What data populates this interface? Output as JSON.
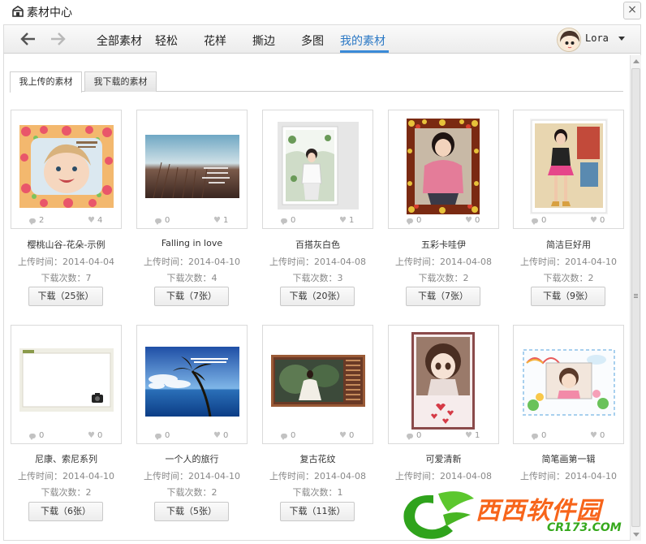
{
  "window": {
    "title": "素材中心",
    "close_glyph": "×"
  },
  "nav": {
    "tabs": [
      "全部素材",
      "轻松",
      "花样",
      "撕边",
      "多图",
      "我的素材"
    ],
    "active_tab_index": 5,
    "user_name": "Lora"
  },
  "sub_tabs": [
    "我上传的素材",
    "我下载的素材"
  ],
  "cards": [
    {
      "title": "樱桃山谷-花朵-示例",
      "date": "上传时间：2014-04-04",
      "downloads": "下载次数：7",
      "comments": "2",
      "likes": "4",
      "button": "下载（25张）"
    },
    {
      "title": "Falling in love",
      "date": "上传时间：2014-04-10",
      "downloads": "下载次数：4",
      "comments": "0",
      "likes": "1",
      "button": "下载（7张）"
    },
    {
      "title": "百搭灰白色",
      "date": "上传时间：2014-04-08",
      "downloads": "下载次数：3",
      "comments": "0",
      "likes": "1",
      "button": "下载（20张）"
    },
    {
      "title": "五彩卡哇伊",
      "date": "上传时间：2014-04-08",
      "downloads": "下载次数：2",
      "comments": "0",
      "likes": "0",
      "button": "下载（7张）"
    },
    {
      "title": "简洁巨好用",
      "date": "上传时间：2014-04-10",
      "downloads": "下载次数：2",
      "comments": "0",
      "likes": "0",
      "button": "下载（9张）"
    },
    {
      "title": "尼康、索尼系列",
      "date": "上传时间：2014-04-10",
      "downloads": "下载次数：2",
      "comments": "0",
      "likes": "0",
      "button": "下载（6张）"
    },
    {
      "title": "一个人的旅行",
      "date": "上传时间：2014-04-10",
      "downloads": "下载次数：2",
      "comments": "0",
      "likes": "0",
      "button": "下载（5张）"
    },
    {
      "title": "复古花纹",
      "date": "上传时间：2014-04-08",
      "downloads": "下载次数：1",
      "comments": "0",
      "likes": "0",
      "button": "下载（11张）"
    },
    {
      "title": "可爱清新",
      "date": "上传时间：2014-04-08",
      "downloads": "",
      "comments": "0",
      "likes": "1",
      "button": ""
    },
    {
      "title": "简笔画第一辑",
      "date": "上传时间：2014-04-10",
      "downloads": "",
      "comments": "0",
      "likes": "0",
      "button": ""
    }
  ],
  "watermark": {
    "brand": "西西软件园",
    "url": "CR173.COM"
  },
  "colors": {
    "accent": "#3a8ad8",
    "watermark_orange": "#f7651b",
    "watermark_green": "#36a81c"
  }
}
